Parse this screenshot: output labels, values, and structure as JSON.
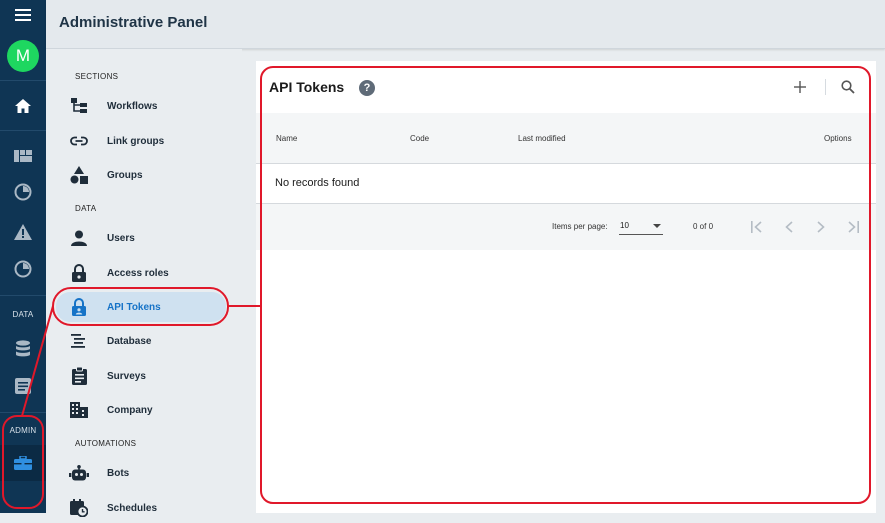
{
  "app": {
    "title": "Administrative Panel"
  },
  "rail": {
    "menu_icon": "menu-icon",
    "avatar_initial": "M",
    "data_label": "DATA",
    "admin_label": "ADMIN"
  },
  "nav": {
    "sections_label": "SECTIONS",
    "data_label": "DATA",
    "automations_label": "AUTOMATIONS",
    "items": [
      {
        "label": "Workflows",
        "icon": "workflow-icon"
      },
      {
        "label": "Link groups",
        "icon": "link-icon"
      },
      {
        "label": "Groups",
        "icon": "shapes-icon"
      },
      {
        "label": "Users",
        "icon": "user-icon"
      },
      {
        "label": "Access roles",
        "icon": "lock-icon"
      },
      {
        "label": "API Tokens",
        "icon": "lock-badge-icon",
        "active": true
      },
      {
        "label": "Database",
        "icon": "database-list-icon"
      },
      {
        "label": "Surveys",
        "icon": "clipboard-icon"
      },
      {
        "label": "Company",
        "icon": "building-icon"
      },
      {
        "label": "Bots",
        "icon": "bot-icon"
      },
      {
        "label": "Schedules",
        "icon": "calendar-clock-icon"
      }
    ]
  },
  "main": {
    "title": "API Tokens",
    "help": "?",
    "columns": [
      "Name",
      "Code",
      "Last modified",
      "Options"
    ],
    "empty_message": "No records found",
    "pagination": {
      "items_per_page_label": "Items per page:",
      "items_per_page_value": "10",
      "range_label": "0 of 0"
    }
  },
  "colors": {
    "rail_bg": "#0f3554",
    "accent": "#1673c7",
    "active_nav_bg": "#cfe1f0",
    "avatar": "#1ed760",
    "annotation": "#e0182a"
  }
}
